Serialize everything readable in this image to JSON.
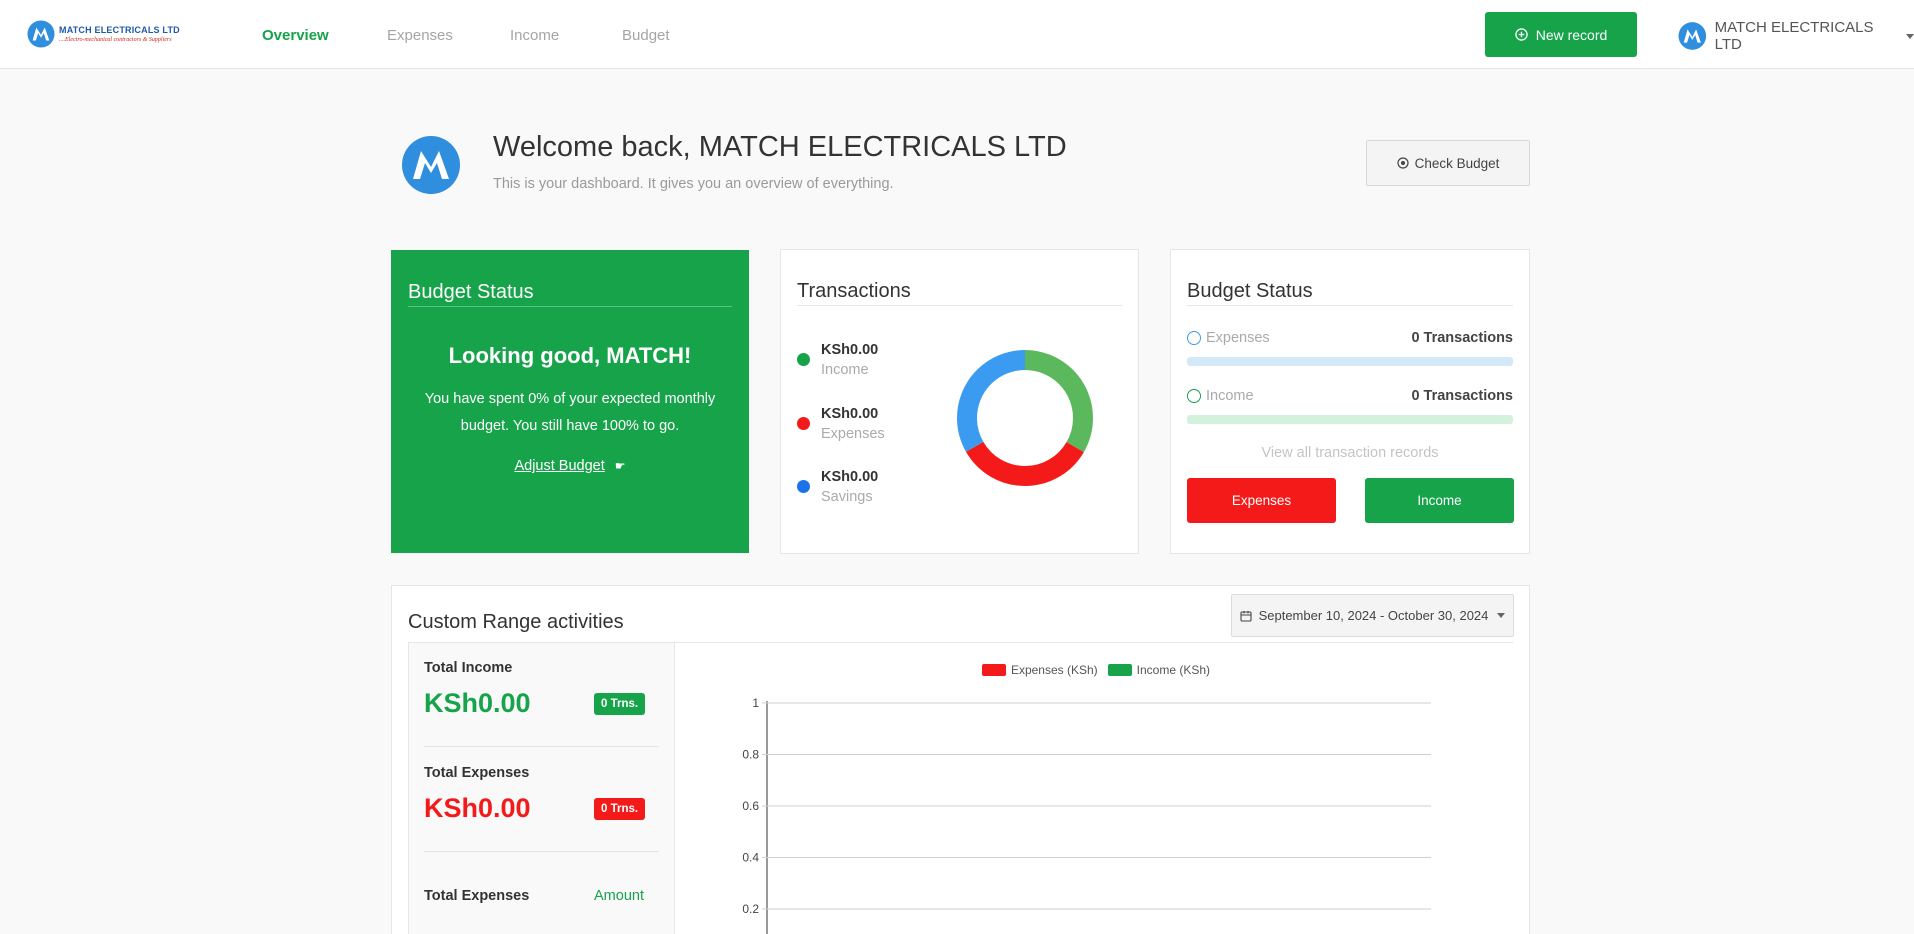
{
  "colors": {
    "green": "#16a34a",
    "red": "#f41a1a",
    "blue": "#3b9bf0",
    "light_green": "#5cb85c",
    "brand_blue": "#2f8fde"
  },
  "brand": {
    "name": "MATCH ELECTRICALS LTD",
    "tagline": "....Electro-mechanical contractors & Suppliers",
    "logo_icon": "match-logo"
  },
  "nav": {
    "links": [
      "Overview",
      "Expenses",
      "Income",
      "Budget"
    ],
    "new_record": "New record",
    "user": "MATCH ELECTRICALS LTD"
  },
  "welcome": {
    "title": "Welcome back, MATCH ELECTRICALS LTD",
    "subtitle": "This is your dashboard. It gives you an overview of everything.",
    "check_budget": "Check Budget"
  },
  "budget_card": {
    "title": "Budget Status",
    "headline": "Looking good, MATCH!",
    "body": "You have spent 0% of your expected monthly budget. You still have 100% to go.",
    "link": "Adjust Budget",
    "link_icon": "pointing-hand-icon"
  },
  "transactions": {
    "title": "Transactions",
    "items": [
      {
        "value": "KSh0.00",
        "label": "Income",
        "color": "#16a34a"
      },
      {
        "value": "KSh0.00",
        "label": "Expenses",
        "color": "#f41a1a"
      },
      {
        "value": "KSh0.00",
        "label": "Savings",
        "color": "#1a73e8"
      }
    ],
    "donut": [
      {
        "label": "Income",
        "share": 0.3333,
        "color": "#5cb85c"
      },
      {
        "label": "Expenses",
        "share": 0.3333,
        "color": "#f41a1a"
      },
      {
        "label": "Savings",
        "share": 0.3334,
        "color": "#3b9bf0"
      }
    ]
  },
  "budget_status": {
    "title": "Budget Status",
    "expenses_label": "Expenses",
    "expenses_count": "0 Transactions",
    "income_label": "Income",
    "income_count": "0 Transactions",
    "view_all": "View all transaction records",
    "expenses_button": "Expenses",
    "income_button": "Income"
  },
  "custom_range": {
    "title": "Custom Range activities",
    "date_range": "September 10, 2024 - October 30, 2024",
    "total_income_label": "Total Income",
    "total_income_value": "KSh0.00",
    "total_income_badge": "0 Trns.",
    "total_expenses_label": "Total Expenses",
    "total_expenses_value": "KSh0.00",
    "total_expenses_badge": "0 Trns.",
    "table_header_label": "Total Expenses",
    "table_header_amount": "Amount"
  },
  "chart_data": {
    "type": "bar",
    "categories": [],
    "series": [
      {
        "name": "Expenses (KSh)",
        "values": [],
        "color": "#f41a1a"
      },
      {
        "name": "Income (KSh)",
        "values": [],
        "color": "#16a34a"
      }
    ],
    "yticks": [
      "1",
      "0.8",
      "0.6",
      "0.4",
      "0.2"
    ],
    "ylim": [
      0,
      1
    ],
    "grid": true,
    "legend": "top"
  }
}
